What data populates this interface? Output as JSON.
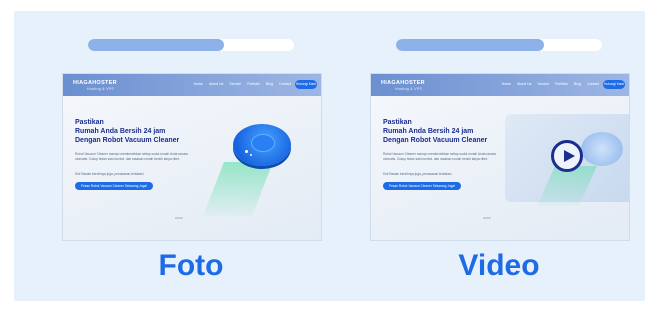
{
  "colors": {
    "accent": "#1e6be6",
    "heading": "#1b2d8f",
    "background": "#e7f1fb"
  },
  "columns": [
    {
      "label": "Foto",
      "progress": 0.66,
      "preview": {
        "logo": "HIAGAHOSTER",
        "logo_sub": "Hosting & VPS",
        "nav": [
          "Home",
          "About Us",
          "Service",
          "Portfolio",
          "Blog",
          "Contact"
        ],
        "cta": "Hubungi Kami",
        "headline": [
          "Pastikan",
          "Rumah Anda Bersih 24 jam",
          "Dengan Robot Vacuum Cleaner"
        ],
        "paragraph": "Robot Vacuum Cleaner mampu membersihkan setiap sudut rumah Anda secara otomatis. Cukup tekan satu tombol, dan rasakan rumah bersih tanpa ribet.",
        "note": "Kini Rasain bersihnya juga, penawaran terbatas!",
        "button": "Pesan Robot Vacuum Cleaner Sekarang Juga!",
        "page": "01/03",
        "media_icon": "robot-vacuum-icon"
      }
    },
    {
      "label": "Video",
      "progress": 0.72,
      "preview": {
        "logo": "HIAGAHOSTER",
        "logo_sub": "Hosting & VPS",
        "nav": [
          "Home",
          "About Us",
          "Service",
          "Portfolio",
          "Blog",
          "Contact"
        ],
        "cta": "Hubungi Kami",
        "headline": [
          "Pastikan",
          "Rumah Anda Bersih 24 jam",
          "Dengan Robot Vacuum Cleaner"
        ],
        "paragraph": "Robot Vacuum Cleaner mampu membersihkan setiap sudut rumah Anda secara otomatis. Cukup tekan satu tombol, dan rasakan rumah bersih tanpa ribet.",
        "note": "Kini Rasain bersihnya juga, penawaran terbatas!",
        "button": "Pesan Robot Vacuum Cleaner Sekarang Juga!",
        "page": "01/03",
        "media_icon": "play-icon"
      }
    }
  ]
}
